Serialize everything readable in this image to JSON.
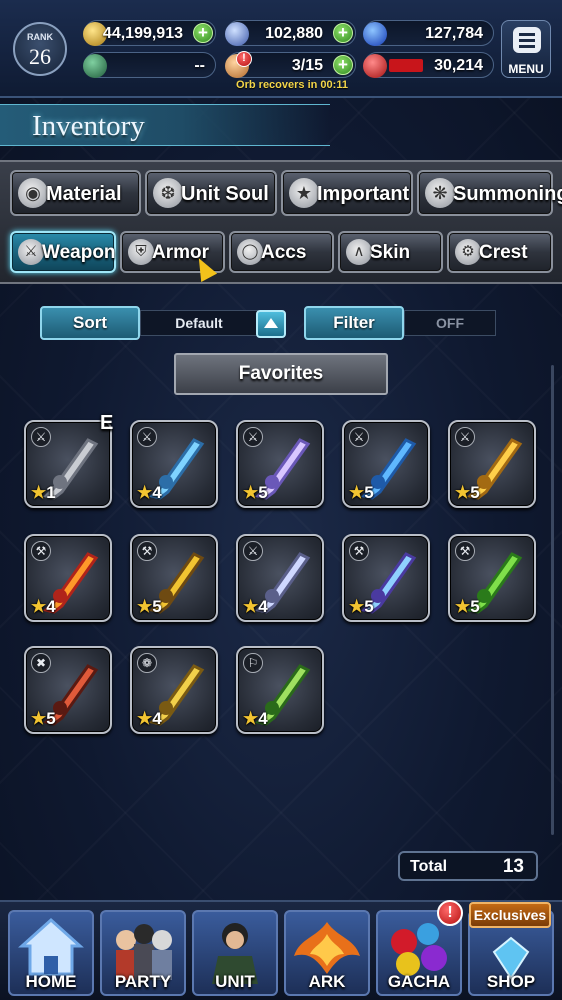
{
  "status": {
    "rank_label": "RANK",
    "rank_value": "26",
    "gil": "44,199,913",
    "lapis": "102,880",
    "blue_stat": "127,784",
    "stamina_display": "--",
    "orbs": "3/15",
    "red_stat": "30,214",
    "orb_timer": "Orb recovers in 00:11",
    "menu_label": "MENU",
    "alert_glyph": "!"
  },
  "header": {
    "title": "Inventory"
  },
  "categories": {
    "row1": [
      {
        "label": "Material",
        "icon": "sack-icon"
      },
      {
        "label": "Unit Soul",
        "icon": "flame-icon"
      },
      {
        "label": "Important",
        "icon": "star-icon"
      },
      {
        "label": "Summoning",
        "icon": "crest-icon"
      }
    ],
    "row2": [
      {
        "label": "Weapon",
        "icon": "sword-icon",
        "active": true
      },
      {
        "label": "Armor",
        "icon": "armor-icon"
      },
      {
        "label": "Accs",
        "icon": "ring-icon"
      },
      {
        "label": "Skin",
        "icon": "hanger-icon"
      },
      {
        "label": "Crest",
        "icon": "gear-icon"
      }
    ]
  },
  "controls": {
    "sort_label": "Sort",
    "sort_value": "Default",
    "filter_label": "Filter",
    "filter_value": "OFF",
    "favorites_label": "Favorites"
  },
  "items": [
    {
      "rarity": "1",
      "type": "dagger",
      "equipped_badge": "E"
    },
    {
      "rarity": "4",
      "type": "sword"
    },
    {
      "rarity": "5",
      "type": "sword"
    },
    {
      "rarity": "5",
      "type": "sword"
    },
    {
      "rarity": "5",
      "type": "sword"
    },
    {
      "rarity": "4",
      "type": "axe"
    },
    {
      "rarity": "5",
      "type": "axe"
    },
    {
      "rarity": "4",
      "type": "sword"
    },
    {
      "rarity": "5",
      "type": "hammer"
    },
    {
      "rarity": "5",
      "type": "hammer"
    },
    {
      "rarity": "5",
      "type": "bow"
    },
    {
      "rarity": "4",
      "type": "gun"
    },
    {
      "rarity": "4",
      "type": "staff"
    }
  ],
  "footer": {
    "total_label": "Total",
    "total_value": "13"
  },
  "nav": {
    "items": [
      "HOME",
      "PARTY",
      "UNIT",
      "ARK",
      "GACHA",
      "SHOP"
    ],
    "exclusives_label": "Exclusives",
    "alert_glyph": "!"
  },
  "colors": {
    "accent": "#2a8cab",
    "gold": "#f2c431",
    "plus_green": "#2f8a1f"
  }
}
